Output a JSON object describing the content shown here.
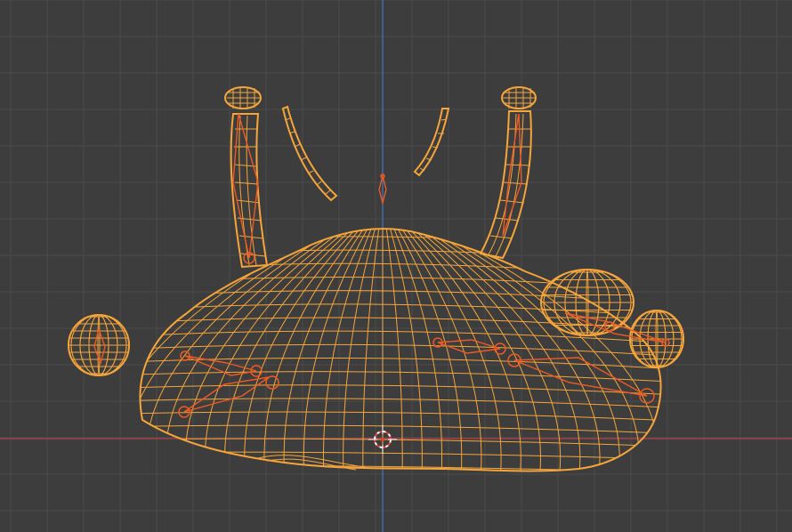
{
  "viewport": {
    "view": "front-orthographic",
    "shading": "wireframe",
    "mode": "pose-with-armature",
    "colors": {
      "background": "#3d3d3d",
      "grid_line": "#4a4a4a",
      "x_axis": "#b3404a",
      "z_axis": "#3f78c4",
      "selected_wireframe": "#f5a53a",
      "armature": "#ee5a24",
      "cursor_ring": "#ffffff",
      "cursor_accent": "#e4452c"
    },
    "objects": [
      {
        "name": "body-mesh",
        "kind": "mesh",
        "selected": true
      },
      {
        "name": "left-eyestalk-mesh",
        "kind": "mesh",
        "selected": true
      },
      {
        "name": "right-eyestalk-mesh",
        "kind": "mesh",
        "selected": true
      },
      {
        "name": "left-antenna-mesh",
        "kind": "mesh",
        "selected": true
      },
      {
        "name": "right-antenna-mesh",
        "kind": "mesh",
        "selected": true
      },
      {
        "name": "left-sphere-mesh",
        "kind": "mesh",
        "selected": true
      },
      {
        "name": "right-spheres-mesh",
        "kind": "mesh",
        "selected": true
      },
      {
        "name": "armature",
        "kind": "armature",
        "selected": true
      }
    ],
    "cursor_icon": "3d-cursor-icon"
  }
}
